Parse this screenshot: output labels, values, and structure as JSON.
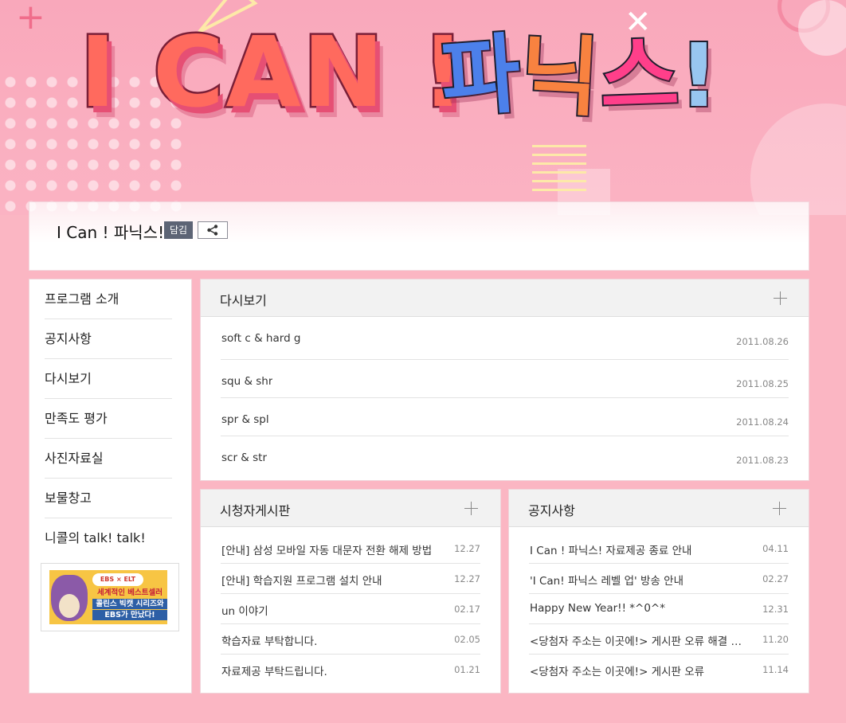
{
  "banner": {
    "title_en": "I CAN !",
    "title_ko": [
      "파",
      "닉",
      "스",
      "!"
    ]
  },
  "header": {
    "program_title": "I Can ! 파닉스!",
    "save_label": "담김",
    "share_icon": "share-icon"
  },
  "sidebar": {
    "items": [
      {
        "label": "프로그램 소개"
      },
      {
        "label": "공지사항"
      },
      {
        "label": "다시보기"
      },
      {
        "label": "만족도 평가"
      },
      {
        "label": "사진자료실"
      },
      {
        "label": "보물창고"
      },
      {
        "label": "니콜의 talk! talk!"
      }
    ],
    "ad": {
      "logo_text": "EBS × ELT",
      "lines": [
        "세계적인 베스트셀러",
        "콜린스 빅캣 시리즈와",
        "EBS가 만났다!"
      ]
    }
  },
  "replay": {
    "title": "다시보기",
    "items": [
      {
        "title": "soft c & hard g",
        "date": "2011.08.26"
      },
      {
        "title": "squ & shr",
        "date": "2011.08.25"
      },
      {
        "title": "spr & spl",
        "date": "2011.08.24"
      },
      {
        "title": "scr & str",
        "date": "2011.08.23"
      }
    ]
  },
  "board": {
    "title": "시청자게시판",
    "items": [
      {
        "title": "[안내] 삼성 모바일 자동 대문자 전환 해제 방법",
        "date": "12.27"
      },
      {
        "title": "[안내] 학습지원 프로그램 설치 안내",
        "date": "12.27"
      },
      {
        "title": "un 이야기",
        "date": "02.17"
      },
      {
        "title": "학습자료 부탁합니다.",
        "date": "02.05"
      },
      {
        "title": "자료제공 부탁드립니다.",
        "date": "01.21"
      }
    ]
  },
  "notice": {
    "title": "공지사항",
    "items": [
      {
        "title": "I Can ! 파닉스! 자료제공 종료 안내",
        "date": "04.11"
      },
      {
        "title": "'I Can! 파닉스 레벨 업' 방송 안내",
        "date": "02.27"
      },
      {
        "title": "Happy New Year!! *^0^*",
        "date": "12.31"
      },
      {
        "title": "<당첨자 주소는 이곳에!> 게시판 오류 해결 ^^",
        "date": "11.20"
      },
      {
        "title": "<당첨자 주소는 이곳에!> 게시판 오류",
        "date": "11.14"
      }
    ]
  },
  "colors": {
    "page_bg": "#fbb6c3",
    "title_en": "#ff6a5e",
    "ko_blue": "#4c80ea",
    "ko_orange": "#f88240",
    "ko_pink": "#ff3f8a",
    "ko_light_blue": "#98c6f0"
  }
}
